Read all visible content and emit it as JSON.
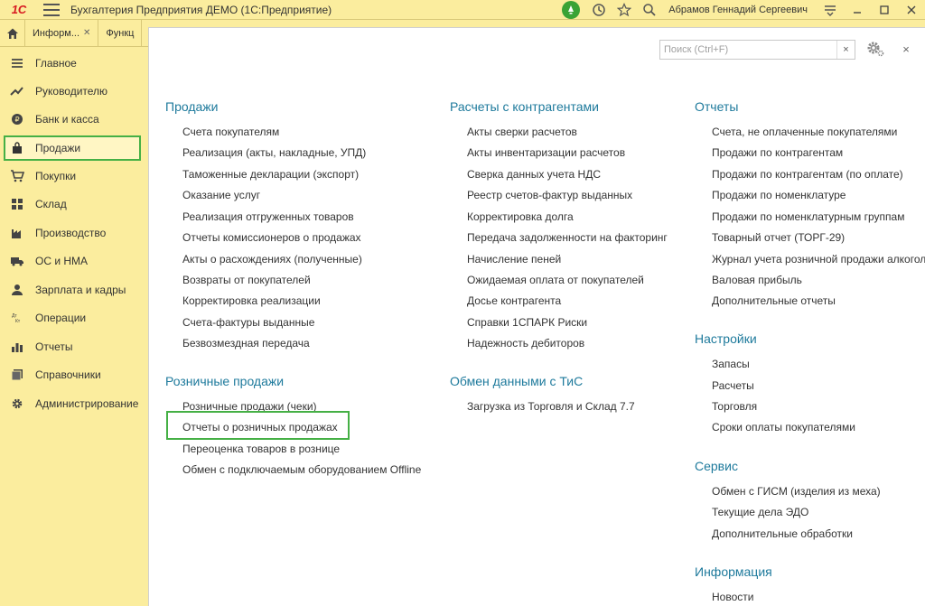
{
  "titlebar": {
    "logo": "1С",
    "title": "Бухгалтерия Предприятия ДЕМО  (1С:Предприятие)",
    "user": "Абрамов Геннадий Сергеевич"
  },
  "tabs": [
    {
      "label": "Информ..."
    },
    {
      "label": "Функц"
    }
  ],
  "sidebar": {
    "items": [
      {
        "label": "Главное",
        "icon": "menu-lines-icon"
      },
      {
        "label": "Руководителю",
        "icon": "trend-icon"
      },
      {
        "label": "Банк и касса",
        "icon": "coin-icon"
      },
      {
        "label": "Продажи",
        "icon": "bag-icon"
      },
      {
        "label": "Покупки",
        "icon": "cart-icon"
      },
      {
        "label": "Склад",
        "icon": "grid-icon"
      },
      {
        "label": "Производство",
        "icon": "factory-icon"
      },
      {
        "label": "ОС и НМА",
        "icon": "truck-icon"
      },
      {
        "label": "Зарплата и кадры",
        "icon": "person-icon"
      },
      {
        "label": "Операции",
        "icon": "dt-kt-icon"
      },
      {
        "label": "Отчеты",
        "icon": "bars-icon"
      },
      {
        "label": "Справочники",
        "icon": "books-icon"
      },
      {
        "label": "Администрирование",
        "icon": "gear-icon"
      }
    ]
  },
  "search": {
    "placeholder": "Поиск (Ctrl+F)",
    "clear": "×"
  },
  "close_label": "×",
  "sections": {
    "sales": {
      "title": "Продажи",
      "items": [
        "Счета покупателям",
        "Реализация (акты, накладные, УПД)",
        "Таможенные декларации (экспорт)",
        "Оказание услуг",
        "Реализация отгруженных товаров",
        "Отчеты комиссионеров о продажах",
        "Акты о расхождениях (полученные)",
        "Возвраты от покупателей",
        "Корректировка реализации",
        "Счета-фактуры выданные",
        "Безвозмездная передача"
      ]
    },
    "retail": {
      "title": "Розничные продажи",
      "items": [
        "Розничные продажи (чеки)",
        "Отчеты о розничных продажах",
        "Переоценка товаров в рознице",
        "Обмен с подключаемым оборудованием Offline"
      ]
    },
    "settlements": {
      "title": "Расчеты с контрагентами",
      "items": [
        "Акты сверки расчетов",
        "Акты инвентаризации расчетов",
        "Сверка данных учета НДС",
        "Реестр счетов-фактур выданных",
        "Корректировка долга",
        "Передача задолженности на факторинг",
        "Начисление пеней",
        "Ожидаемая оплата от покупателей",
        "Досье контрагента",
        "Справки 1СПАРК Риски",
        "Надежность дебиторов"
      ]
    },
    "exchange": {
      "title": "Обмен данными с ТиС",
      "items": [
        "Загрузка из Торговля и Склад 7.7"
      ]
    },
    "reports": {
      "title": "Отчеты",
      "items": [
        "Счета, не оплаченные покупателями",
        "Продажи по контрагентам",
        "Продажи по контрагентам (по оплате)",
        "Продажи по номенклатуре",
        "Продажи по номенклатурным группам",
        "Товарный отчет (ТОРГ-29)",
        "Журнал учета розничной продажи алкоголь",
        "Валовая прибыль",
        "Дополнительные отчеты"
      ]
    },
    "settings": {
      "title": "Настройки",
      "items": [
        "Запасы",
        "Расчеты",
        "Торговля",
        "Сроки оплаты покупателями"
      ]
    },
    "service": {
      "title": "Сервис",
      "items": [
        "Обмен с ГИСМ (изделия из меха)",
        "Текущие дела ЭДО",
        "Дополнительные обработки"
      ]
    },
    "info": {
      "title": "Информация",
      "items": [
        "Новости"
      ]
    }
  },
  "colors": {
    "accent": "#1e7a9c",
    "highlight": "#45b045",
    "panel": "#fbed9e"
  }
}
